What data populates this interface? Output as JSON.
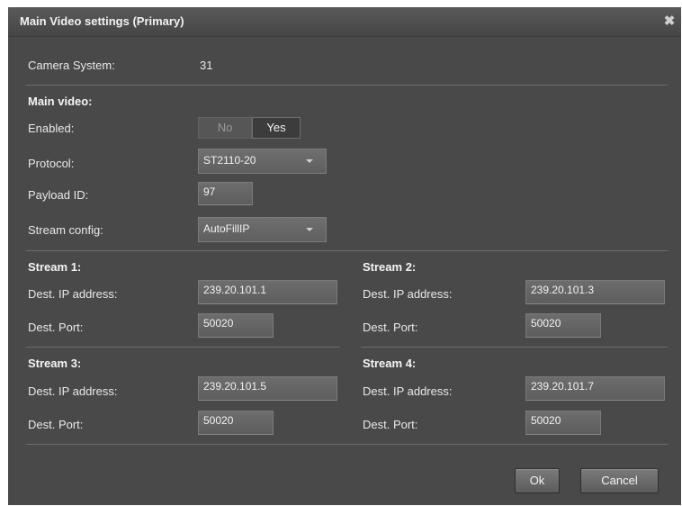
{
  "dialog": {
    "title": "Main Video settings (Primary)",
    "close_glyph": "✖"
  },
  "camera_system": {
    "label": "Camera System:",
    "value": "31"
  },
  "main_video": {
    "heading": "Main video:",
    "enabled": {
      "label": "Enabled:",
      "options": [
        "No",
        "Yes"
      ],
      "selected": "Yes"
    },
    "protocol": {
      "label": "Protocol:",
      "value": "ST2110-20"
    },
    "payload_id": {
      "label": "Payload ID:",
      "value": "97"
    },
    "stream_config": {
      "label": "Stream config:",
      "value": "AutoFillIP"
    }
  },
  "streams": [
    {
      "heading": "Stream 1:",
      "ip_label": "Dest. IP address:",
      "ip": "239.20.101.1",
      "port_label": "Dest. Port:",
      "port": "50020"
    },
    {
      "heading": "Stream 2:",
      "ip_label": "Dest. IP address:",
      "ip": "239.20.101.3",
      "port_label": "Dest. Port:",
      "port": "50020"
    },
    {
      "heading": "Stream 3:",
      "ip_label": "Dest. IP address:",
      "ip": "239.20.101.5",
      "port_label": "Dest. Port:",
      "port": "50020"
    },
    {
      "heading": "Stream 4:",
      "ip_label": "Dest. IP address:",
      "ip": "239.20.101.7",
      "port_label": "Dest. Port:",
      "port": "50020"
    }
  ],
  "buttons": {
    "ok": "Ok",
    "cancel": "Cancel"
  },
  "colors": {
    "background": "#494949",
    "titlebar": "#505050",
    "field": "#666666",
    "text": "#e9e9e9"
  },
  "icons": {
    "close": "close-icon",
    "dropdown": "chevron-down-icon"
  }
}
